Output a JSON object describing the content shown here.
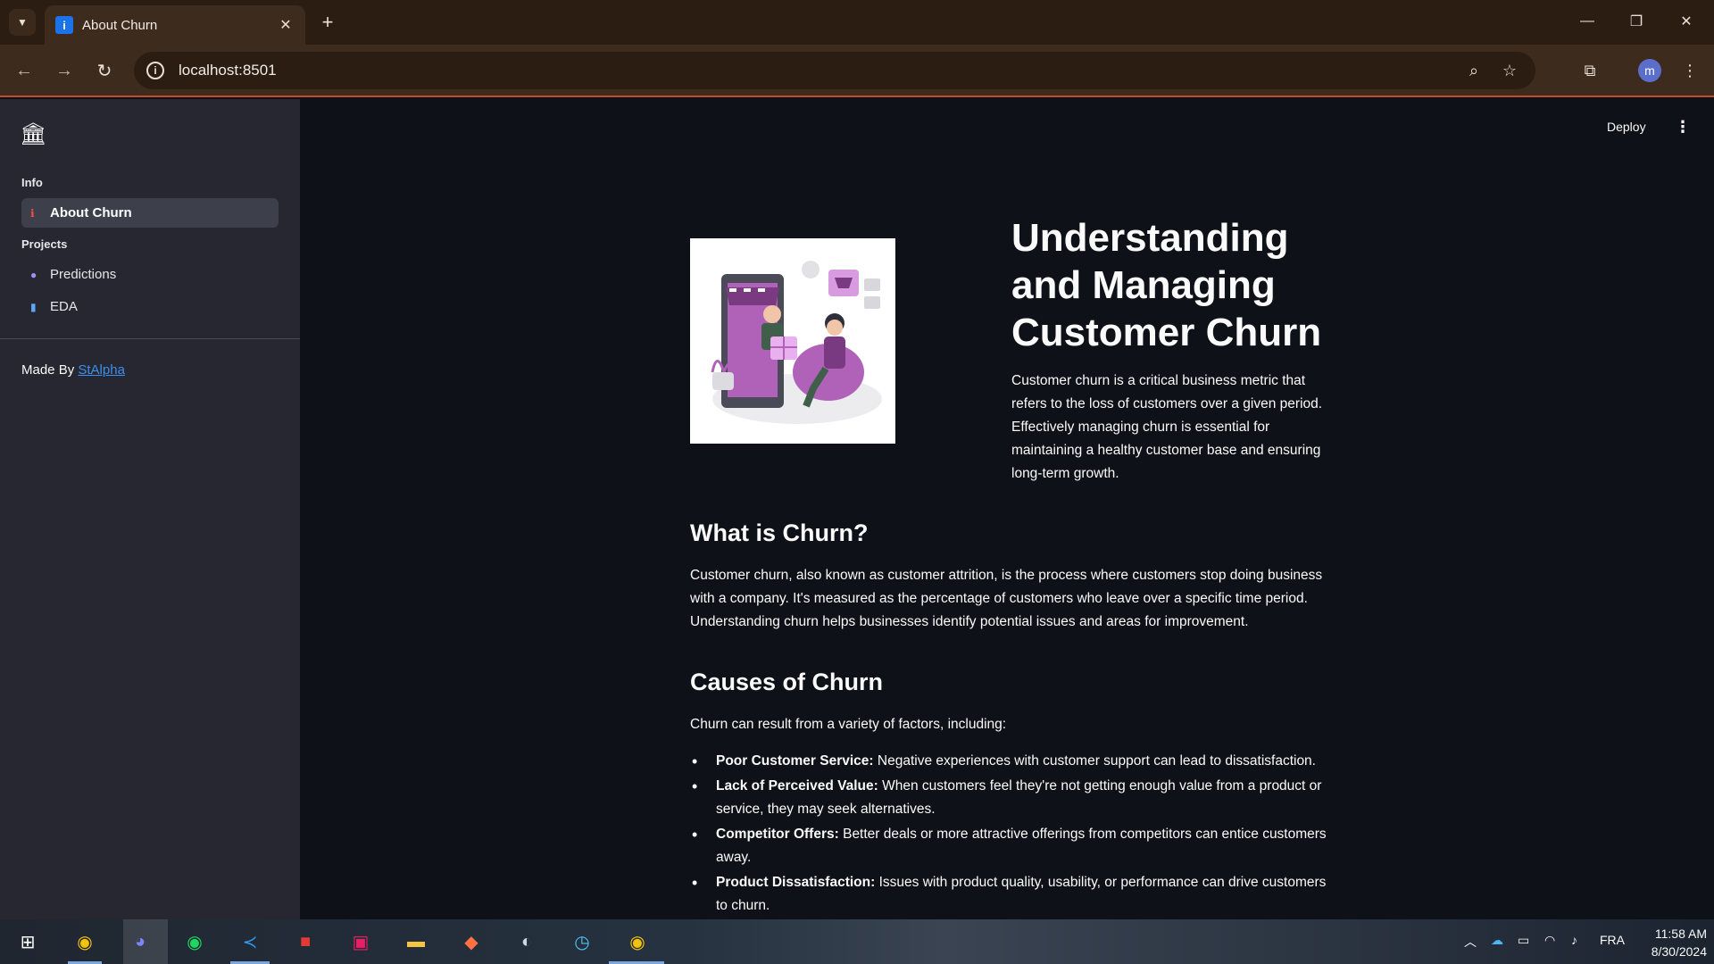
{
  "browser": {
    "tab_title": "About Churn",
    "tab_favicon": "i",
    "url": "localhost:8501",
    "profile_initial": "m"
  },
  "sidebar": {
    "sections": [
      {
        "label": "Info"
      },
      {
        "label": "Projects"
      }
    ],
    "items": [
      {
        "label": "About Churn",
        "icon": "info-icon",
        "active": true
      },
      {
        "label": "Predictions",
        "icon": "crystal-ball-icon",
        "active": false
      },
      {
        "label": "EDA",
        "icon": "bar-chart-icon",
        "active": false
      }
    ],
    "made_by_prefix": "Made By",
    "made_by_link": "StAlpha"
  },
  "header": {
    "deploy_label": "Deploy"
  },
  "main": {
    "title": "Understanding and Managing Customer Churn",
    "intro": "Customer churn is a critical business metric that refers to the loss of customers over a given period. Effectively managing churn is essential for maintaining a healthy customer base and ensuring long-term growth.",
    "what_heading": "What is Churn?",
    "what_text": "Customer churn, also known as customer attrition, is the process where customers stop doing business with a company. It's measured as the percentage of customers who leave over a specific time period. Understanding churn helps businesses identify potential issues and areas for improvement.",
    "causes_heading": "Causes of Churn",
    "causes_intro": "Churn can result from a variety of factors, including:",
    "causes": [
      {
        "term": "Poor Customer Service:",
        "text": " Negative experiences with customer support can lead to dissatisfaction."
      },
      {
        "term": "Lack of Perceived Value:",
        "text": " When customers feel they're not getting enough value from a product or service, they may seek alternatives."
      },
      {
        "term": "Competitor Offers:",
        "text": " Better deals or more attractive offerings from competitors can entice customers away."
      },
      {
        "term": "Product Dissatisfaction:",
        "text": " Issues with product quality, usability, or performance can drive customers to churn."
      }
    ]
  },
  "taskbar": {
    "language": "FRA",
    "time": "11:58 AM",
    "date": "8/30/2024"
  },
  "colors": {
    "app_bg": "#0e1117",
    "sidebar_bg": "#262730",
    "link": "#3d8ff0",
    "browser_frame": "#3d2b1d"
  }
}
